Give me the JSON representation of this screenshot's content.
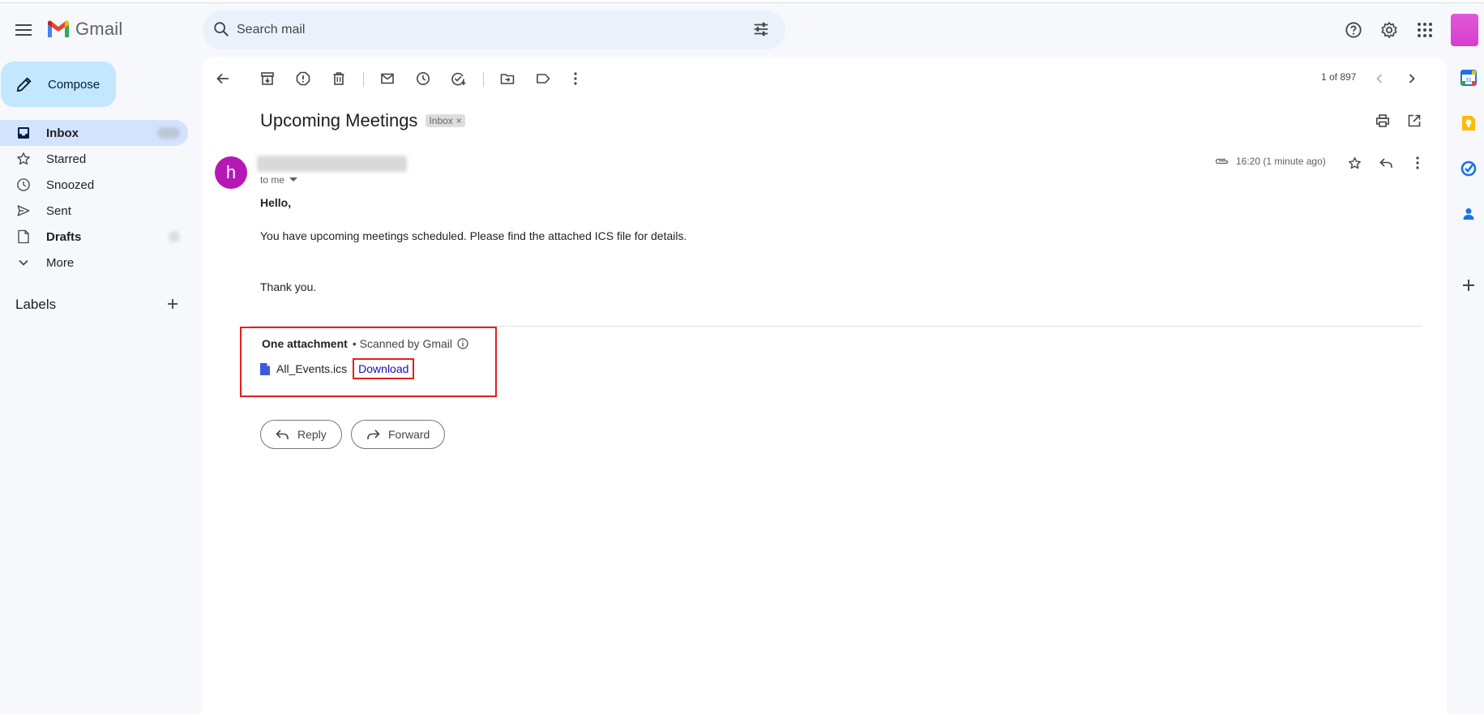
{
  "app": {
    "name": "Gmail"
  },
  "search": {
    "placeholder": "Search mail"
  },
  "compose": {
    "label": "Compose"
  },
  "sidebar": {
    "items": [
      {
        "label": "Inbox",
        "icon": "inbox-icon",
        "active": true
      },
      {
        "label": "Starred",
        "icon": "star-icon"
      },
      {
        "label": "Snoozed",
        "icon": "clock-icon"
      },
      {
        "label": "Sent",
        "icon": "send-icon"
      },
      {
        "label": "Drafts",
        "icon": "draft-icon"
      },
      {
        "label": "More",
        "icon": "chevron-down-icon"
      }
    ],
    "labels_header": "Labels"
  },
  "toolbar": {
    "page_count": "1 of 897"
  },
  "email": {
    "subject": "Upcoming Meetings",
    "label_chip": "Inbox",
    "avatar_letter": "h",
    "to": "to me",
    "time": "16:20 (1 minute ago)",
    "greeting": "Hello,",
    "body": "You have upcoming meetings scheduled. Please find the attached ICS file for details.",
    "closing": "Thank you."
  },
  "attachments": {
    "header": "One attachment",
    "scanned": "• Scanned by Gmail",
    "file_name": "All_Events.ics",
    "download_label": "Download"
  },
  "actions": {
    "reply": "Reply",
    "forward": "Forward"
  },
  "colors": {
    "accent": "#c2e7ff",
    "active_nav": "#d3e3fd",
    "avatar": "#b518b5",
    "highlight": "#e02020"
  }
}
